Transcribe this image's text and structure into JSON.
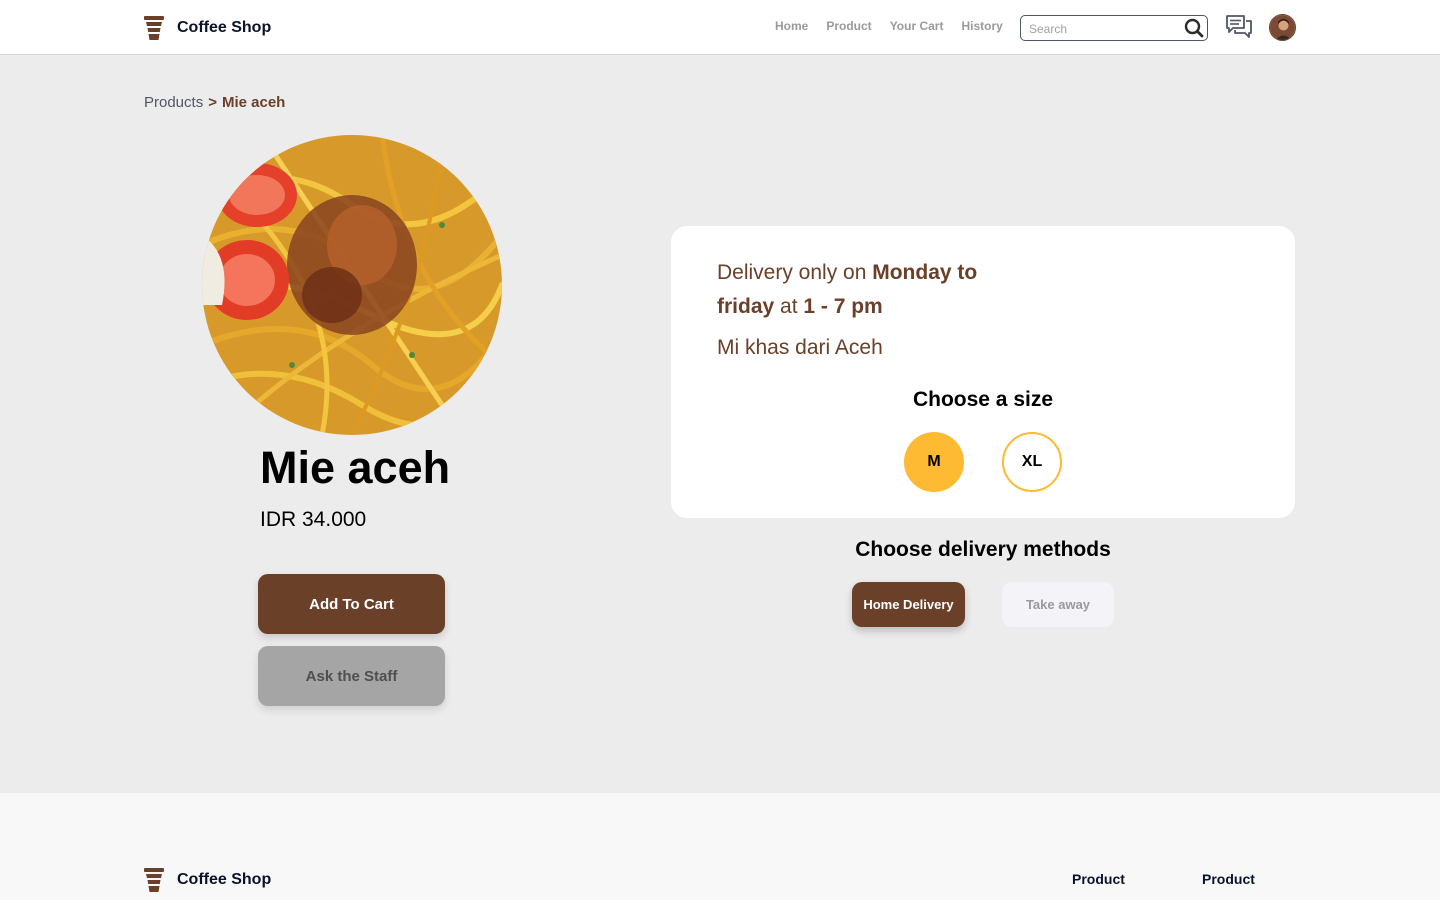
{
  "header": {
    "brand": "Coffee Shop",
    "nav": [
      "Home",
      "Product",
      "Your Cart",
      "History"
    ],
    "search_placeholder": "Search"
  },
  "breadcrumb": {
    "parent": "Products",
    "separator": ">",
    "current": "Mie aceh"
  },
  "product": {
    "name": "Mie aceh",
    "price": "IDR 34.000",
    "add_to_cart": "Add To Cart",
    "ask_staff": "Ask the Staff"
  },
  "info": {
    "delivery_prefix": "Delivery only on ",
    "delivery_days": "Monday to friday",
    "delivery_mid": " at ",
    "delivery_hours": "1 - 7 pm",
    "description": "Mi khas dari Aceh",
    "size_title": "Choose a size",
    "sizes": [
      "M",
      "XL"
    ],
    "selected_size": "M"
  },
  "delivery": {
    "title": "Choose delivery methods",
    "methods": [
      "Home Delivery",
      "Take away"
    ],
    "selected": "Home Delivery"
  },
  "footer": {
    "brand": "Coffee Shop",
    "columns": [
      "Product",
      "Product"
    ]
  },
  "colors": {
    "brown": "#6a4029",
    "yellow": "#ffba33",
    "grey_button": "#a5a5a5",
    "background": "#ececec"
  }
}
